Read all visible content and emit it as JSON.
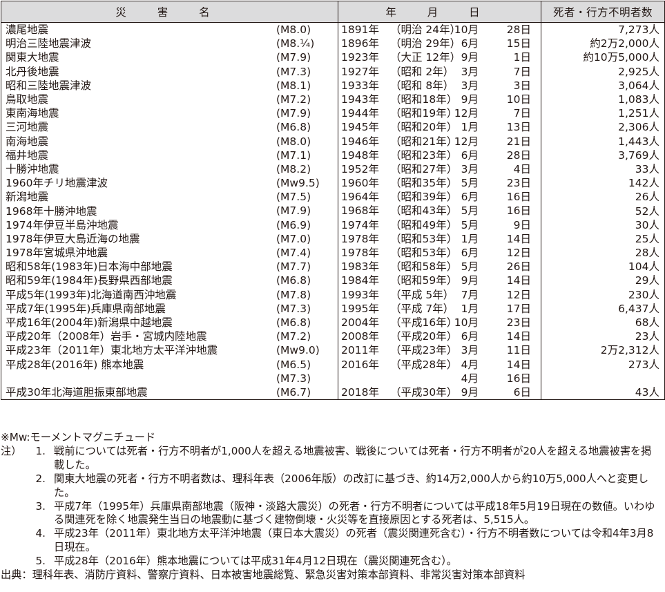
{
  "table": {
    "headers": [
      "災 害 名",
      "年 月 日",
      "死者・行方不明者数"
    ],
    "rows": [
      {
        "name": "濃尾地震",
        "mag": "(M8.0)",
        "year": "1891年",
        "era": "（明治 24年）",
        "month": "10月",
        "day": "28日",
        "deaths": "7,273人"
      },
      {
        "name": "明治三陸地震津波",
        "mag": "(M8.¼)",
        "year": "1896年",
        "era": "（明治 29年）",
        "month": "6月",
        "day": "15日",
        "deaths": "約2万2,000人"
      },
      {
        "name": "関東大地震",
        "mag": "(M7.9)",
        "year": "1923年",
        "era": "（大正 12年）",
        "month": "9月",
        "day": "1日",
        "deaths": "約10万5,000人"
      },
      {
        "name": "北丹後地震",
        "mag": "(M7.3)",
        "year": "1927年",
        "era": "（昭和 2年）",
        "month": "3月",
        "day": "7日",
        "deaths": "2,925人"
      },
      {
        "name": "昭和三陸地震津波",
        "mag": "(M8.1)",
        "year": "1933年",
        "era": "（昭和 8年）",
        "month": "3月",
        "day": "3日",
        "deaths": "3,064人"
      },
      {
        "name": "鳥取地震",
        "mag": "(M7.2)",
        "year": "1943年",
        "era": "（昭和18年）",
        "month": "9月",
        "day": "10日",
        "deaths": "1,083人"
      },
      {
        "name": "東南海地震",
        "mag": "(M7.9)",
        "year": "1944年",
        "era": "（昭和19年）",
        "month": "12月",
        "day": "7日",
        "deaths": "1,251人"
      },
      {
        "name": "三河地震",
        "mag": "(M6.8)",
        "year": "1945年",
        "era": "（昭和20年）",
        "month": "1月",
        "day": "13日",
        "deaths": "2,306人"
      },
      {
        "name": "南海地震",
        "mag": "(M8.0)",
        "year": "1946年",
        "era": "（昭和21年）",
        "month": "12月",
        "day": "21日",
        "deaths": "1,443人"
      },
      {
        "name": "福井地震",
        "mag": "(M7.1)",
        "year": "1948年",
        "era": "（昭和23年）",
        "month": "6月",
        "day": "28日",
        "deaths": "3,769人"
      },
      {
        "name": "十勝沖地震",
        "mag": "(M8.2)",
        "year": "1952年",
        "era": "（昭和27年）",
        "month": "3月",
        "day": "4日",
        "deaths": "33人"
      },
      {
        "name": "1960年チリ地震津波",
        "mag": "(Mw9.5)",
        "year": "1960年",
        "era": "（昭和35年）",
        "month": "5月",
        "day": "23日",
        "deaths": "142人"
      },
      {
        "name": "新潟地震",
        "mag": "(M7.5)",
        "year": "1964年",
        "era": "（昭和39年）",
        "month": "6月",
        "day": "16日",
        "deaths": "26人"
      },
      {
        "name": "1968年十勝沖地震",
        "mag": "(M7.9)",
        "year": "1968年",
        "era": "（昭和43年）",
        "month": "5月",
        "day": "16日",
        "deaths": "52人"
      },
      {
        "name": "1974年伊豆半島沖地震",
        "mag": "(M6.9)",
        "year": "1974年",
        "era": "（昭和49年）",
        "month": "5月",
        "day": "9日",
        "deaths": "30人"
      },
      {
        "name": "1978年伊豆大島近海の地震",
        "mag": "(M7.0)",
        "year": "1978年",
        "era": "（昭和53年）",
        "month": "1月",
        "day": "14日",
        "deaths": "25人"
      },
      {
        "name": "1978年宮城県沖地震",
        "mag": "(M7.4)",
        "year": "1978年",
        "era": "（昭和53年）",
        "month": "6月",
        "day": "12日",
        "deaths": "28人"
      },
      {
        "name": "昭和58年(1983年)日本海中部地震",
        "mag": "(M7.7)",
        "year": "1983年",
        "era": "（昭和58年）",
        "month": "5月",
        "day": "26日",
        "deaths": "104人"
      },
      {
        "name": "昭和59年(1984年)長野県西部地震",
        "mag": "(M6.8)",
        "year": "1984年",
        "era": "（昭和59年）",
        "month": "9月",
        "day": "14日",
        "deaths": "29人"
      },
      {
        "name": "平成5年(1993年)北海道南西沖地震",
        "mag": "(M7.8)",
        "year": "1993年",
        "era": "（平成 5年）",
        "month": "7月",
        "day": "12日",
        "deaths": "230人"
      },
      {
        "name": "平成7年(1995年)兵庫県南部地震",
        "mag": "(M7.3)",
        "year": "1995年",
        "era": "（平成 7年）",
        "month": "1月",
        "day": "17日",
        "deaths": "6,437人"
      },
      {
        "name": "平成16年(2004年)新潟県中越地震",
        "mag": "(M6.8)",
        "year": "2004年",
        "era": "（平成16年）",
        "month": "10月",
        "day": "23日",
        "deaths": "68人"
      },
      {
        "name": "平成20年（2008年）岩手・宮城内陸地震",
        "mag": "(M7.2)",
        "year": "2008年",
        "era": "（平成20年）",
        "month": "6月",
        "day": "14日",
        "deaths": "23人"
      },
      {
        "name": "平成23年（2011年）東北地方太平洋沖地震",
        "mag": "(Mw9.0)",
        "year": "2011年",
        "era": "（平成23年）",
        "month": "3月",
        "day": "11日",
        "deaths": "2万2,312人"
      },
      {
        "name": "平成28年(2016年) 熊本地震",
        "mag": "(M6.5)",
        "year": "2016年",
        "era": "（平成28年）",
        "month": "4月",
        "day": "14日",
        "deaths": "273人"
      },
      {
        "name": "",
        "mag": "(M7.3)",
        "year": "",
        "era": "",
        "month": "4月",
        "day": "16日",
        "deaths": ""
      },
      {
        "name": "平成30年北海道胆振東部地震",
        "mag": "(M6.7)",
        "year": "2018年",
        "era": "（平成30年）",
        "month": "9月",
        "day": "6日",
        "deaths": "43人"
      }
    ]
  },
  "notes": {
    "mw": "※Mw:モーメントマグニチュード",
    "label": "注）",
    "items": [
      {
        "num": "1.",
        "text": "戦前については死者・行方不明者が1,000人を超える地震被害、戦後については死者・行方不明者が20人を超える地震被害を掲載した。"
      },
      {
        "num": "2.",
        "text": "関東大地震の死者・行方不明者数は、理科年表（2006年版）の改訂に基づき、約14万2,000人から約10万5,000人へと変更した。"
      },
      {
        "num": "3.",
        "text": "平成7年（1995年）兵庫県南部地震（阪神・淡路大震災）の死者・行方不明者については平成18年5月19日現在の数値。いわゆる関連死を除く地震発生当日の地震動に基づく建物倒壊・火災等を直接原因とする死者は、5,515人。"
      },
      {
        "num": "4.",
        "text": "平成23年（2011年）東北地方太平洋沖地震（東日本大震災）の死者（震災関連死含む）・行方不明者数については令和4年3月8日現在。"
      },
      {
        "num": "5.",
        "text": "平成28年（2016年）熊本地震については平成31年4月12日現在（震災関連死含む）。"
      }
    ],
    "source": "出典：理科年表、消防庁資料、警察庁資料、日本被害地震総覧、緊急災害対策本部資料、非常災害対策本部資料"
  }
}
